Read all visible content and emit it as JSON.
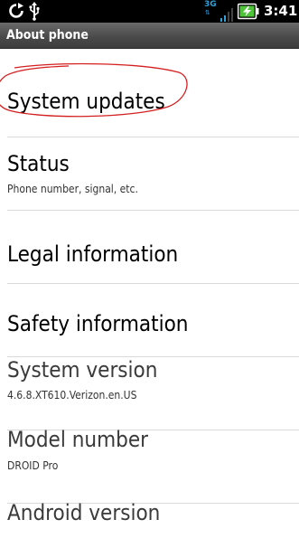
{
  "status_bar": {
    "network_label": "3G",
    "time": "3:41",
    "icons": [
      "sync-icon",
      "usb-icon",
      "signal-icon",
      "battery-charging-icon"
    ]
  },
  "title_bar": {
    "title": "About phone"
  },
  "list": {
    "items": [
      {
        "title": "System updates"
      },
      {
        "title": "Status",
        "subtitle": "Phone number, signal, etc."
      },
      {
        "title": "Legal information"
      },
      {
        "title": "Safety information"
      },
      {
        "title": "System version",
        "subtitle": "4.6.8.XT610.Verizon.en.US"
      },
      {
        "title": "Model number",
        "subtitle": "DROID Pro"
      },
      {
        "title": "Android version"
      }
    ]
  },
  "colors": {
    "status_bar": "#000000",
    "title_bar": "#555555",
    "annotation": "#d42020",
    "network": "#2fa0d8"
  }
}
